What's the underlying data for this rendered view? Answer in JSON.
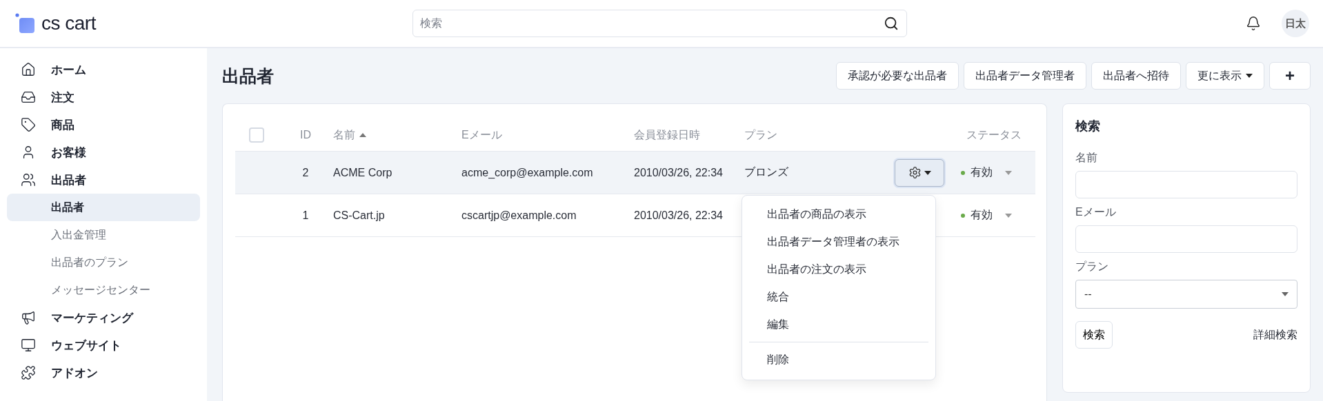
{
  "header": {
    "logo": "cs cart",
    "search": {
      "placeholder": "検索"
    },
    "avatar": "日太"
  },
  "sidebar": {
    "items": [
      {
        "label": "ホーム",
        "selected": false
      },
      {
        "label": "注文",
        "selected": false
      },
      {
        "label": "商品",
        "selected": false
      },
      {
        "label": "お客様",
        "selected": false
      },
      {
        "label": "出品者",
        "selected": false,
        "children": [
          {
            "label": "出品者",
            "selected": true
          },
          {
            "label": "入出金管理",
            "selected": false
          },
          {
            "label": "出品者のプラン",
            "selected": false
          },
          {
            "label": "メッセージセンター",
            "selected": false
          }
        ]
      },
      {
        "label": "マーケティング",
        "selected": false
      },
      {
        "label": "ウェブサイト",
        "selected": false
      },
      {
        "label": "アドオン",
        "selected": false
      }
    ]
  },
  "page": {
    "title": "出品者",
    "actions": [
      {
        "label": "承認が必要な出品者",
        "kind": "text"
      },
      {
        "label": "出品者データ管理者",
        "kind": "text"
      },
      {
        "label": "出品者へ招待",
        "kind": "text"
      },
      {
        "label": "更に表示",
        "kind": "dropdown"
      },
      {
        "label": "+",
        "kind": "icon"
      }
    ]
  },
  "table": {
    "select_all": {
      "checked": false
    },
    "columns": [
      {
        "label": "ID",
        "sorted": false
      },
      {
        "label": "名前",
        "sorted": true
      },
      {
        "label": "Eメール",
        "sorted": false
      },
      {
        "label": "会員登録日時",
        "sorted": false
      },
      {
        "label": "プラン",
        "sorted": false
      },
      {
        "label": "ステータス",
        "sorted": false
      }
    ],
    "rows": [
      {
        "id": "2",
        "name": "ACME Corp",
        "email": "acme_corp@example.com",
        "registered": "2010/03/26, 22:34",
        "plan": "ブロンズ",
        "status": "有効",
        "color": "#6aaa4a",
        "selected": true,
        "menu_open": true,
        "menu": [
          {
            "label": "出品者の商品の表示",
            "kind": "item"
          },
          {
            "label": "出品者データ管理者の表示",
            "kind": "item"
          },
          {
            "label": "出品者の注文の表示",
            "kind": "item"
          },
          {
            "label": "統合",
            "kind": "item"
          },
          {
            "label": "編集",
            "kind": "item"
          },
          {
            "label": "削除",
            "kind": "separated"
          }
        ]
      },
      {
        "id": "1",
        "name": "CS-Cart.jp",
        "email": "cscartjp@example.com",
        "registered": "2010/03/26, 22:34",
        "status": "有効",
        "color": "#6aaa4a",
        "selected": false
      }
    ]
  },
  "search_panel": {
    "title": "検索",
    "fields": [
      {
        "label": "名前",
        "kind": "input"
      },
      {
        "label": "Eメール",
        "kind": "input"
      },
      {
        "label": "プラン",
        "kind": "select",
        "value": "--"
      }
    ],
    "button": "検索",
    "link": "詳細検索"
  }
}
